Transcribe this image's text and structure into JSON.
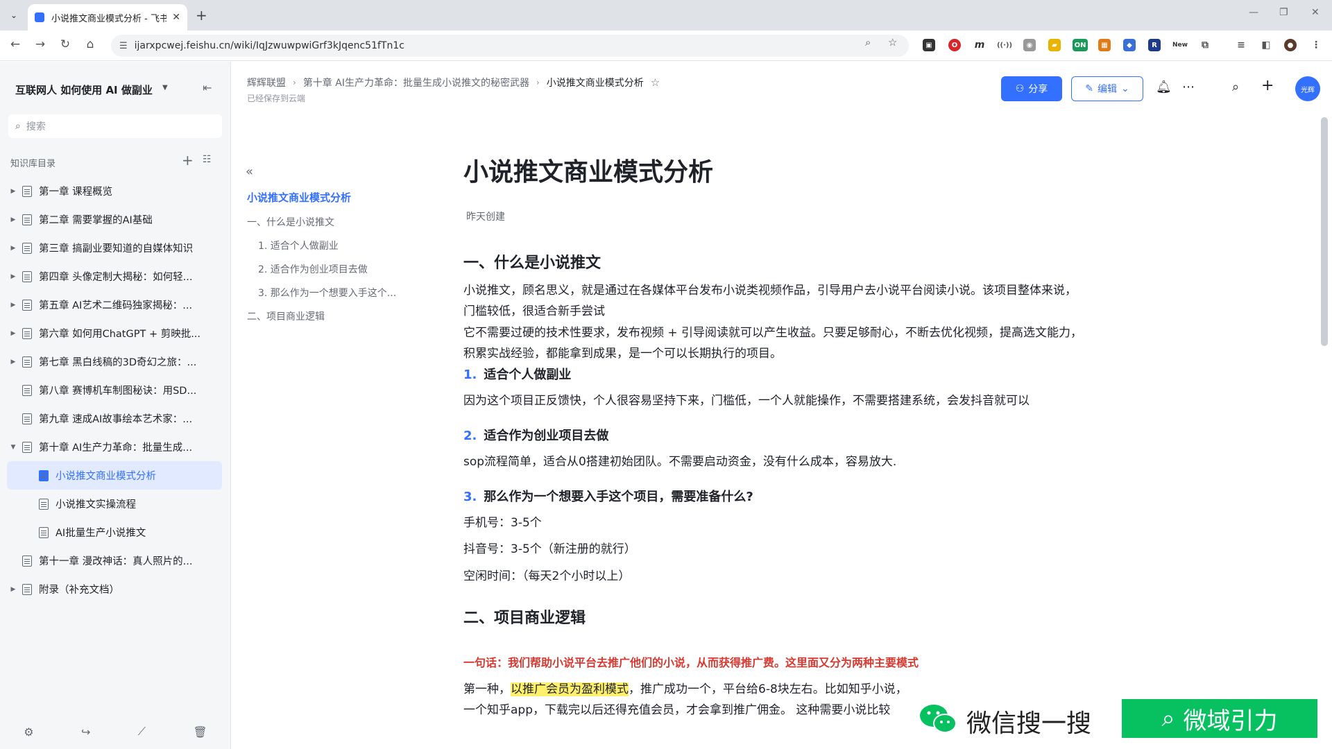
{
  "browser": {
    "tab_title": "小说推文商业模式分析 - 飞书云文档",
    "url": "ijarxpcwej.feishu.cn/wiki/IqJzwuwpwiGrf3kJqenc51fTn1c",
    "new_label": "New"
  },
  "sidebar": {
    "space_title": "互联网人 如何使用 AI 做副业",
    "search_placeholder": "搜索",
    "tree_heading": "知识库目录",
    "items": [
      {
        "label": "第一章 课程概览"
      },
      {
        "label": "第二章 需要掌握的AI基础"
      },
      {
        "label": "第三章 搞副业要知道的自媒体知识"
      },
      {
        "label": "第四章 头像定制大揭秘：如何轻..."
      },
      {
        "label": "第五章 AI艺术二维码独家揭秘：..."
      },
      {
        "label": "第六章 如何用ChatGPT + 剪映批..."
      },
      {
        "label": "第七章 黑白线稿的3D奇幻之旅：..."
      },
      {
        "label": "第八章 赛博机车制图秘诀：用SD..."
      },
      {
        "label": "第九章 速成AI故事绘本艺术家：..."
      },
      {
        "label": "第十章 AI生产力革命：批量生成..."
      },
      {
        "label": "小说推文商业模式分析"
      },
      {
        "label": "小说推文实操流程"
      },
      {
        "label": "AI批量生产小说推文"
      },
      {
        "label": "第十一章 漫改神话：真人照片的..."
      },
      {
        "label": "附录（补充文档）"
      }
    ]
  },
  "header": {
    "crumbs": [
      "辉辉联盟",
      "第十章 AI生产力革命：批量生成小说推文的秘密武器",
      "小说推文商业模式分析"
    ],
    "saved": "已经保存到云端",
    "share_label": "分享",
    "edit_label": "编辑",
    "avatar_text": "光辉"
  },
  "outline": {
    "title": "小说推文商业模式分析",
    "items": [
      "一、什么是小说推文",
      "1. 适合个人做副业",
      "2. 适合作为创业项目去做",
      "3. 那么作为一个想要入手这个...",
      "二、项目商业逻辑"
    ]
  },
  "doc": {
    "title": "小说推文商业模式分析",
    "meta": "昨天创建",
    "h1_a": "一、什么是小说推文",
    "p1": "小说推文，顾名思义，就是通过在各媒体平台发布小说类视频作品，引导用户去小说平台阅读小说。该项目整体来说，门槛较低，很适合新手尝试",
    "p2": "它不需要过硬的技术性要求，发布视频 + 引导阅读就可以产生收益。只要足够耐心，不断去优化视频，提高选文能力，积累实战经验，都能拿到成果，是一个可以长期执行的项目。",
    "h2_1_num": "1.",
    "h2_1": "适合个人做副业",
    "p3": "因为这个项目正反馈快，个人很容易坚持下来，门槛低，一个人就能操作，不需要搭建系统，会发抖音就可以",
    "h2_2_num": "2.",
    "h2_2": "适合作为创业项目去做",
    "p4": "sop流程简单，适合从0搭建初始团队。不需要启动资金，没有什么成本，容易放大.",
    "h2_3_num": "3.",
    "h2_3": "那么作为一个想要入手这个项目，需要准备什么?",
    "p5": "手机号：3-5个",
    "p6": "抖音号：3-5个（新注册的就行）",
    "p7": "空闲时间：（每天2个小时以上）",
    "h1_b": "二、项目商业逻辑",
    "p8": "一句话：我们帮助小说平台去推广他们的小说，从而获得推广费。这里面又分为两种主要模式",
    "p9_a": "第一种，",
    "p9_hl": "以推广会员为盈利模式",
    "p9_b": "，推广成功一个，平台给6-8块左右。比如知乎小说，",
    "p10": "一个知乎app，下载完以后还得充值会员，才会拿到推广佣金。 这种需要小说比较"
  },
  "ad": {
    "wx_text": "微信搜一搜",
    "badge_text": "微域引力"
  }
}
